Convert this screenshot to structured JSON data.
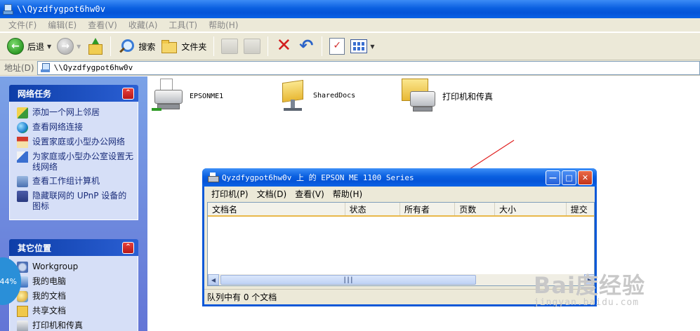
{
  "window": {
    "title": "\\\\Qyzdfygpot6hw0v"
  },
  "menubar": [
    {
      "label": "文件(F)"
    },
    {
      "label": "编辑(E)"
    },
    {
      "label": "查看(V)"
    },
    {
      "label": "收藏(A)"
    },
    {
      "label": "工具(T)"
    },
    {
      "label": "帮助(H)"
    }
  ],
  "toolbar": {
    "back_label": "后退",
    "search_label": "搜索",
    "folders_label": "文件夹"
  },
  "address": {
    "label": "地址(D)",
    "value": "\\\\Qyzdfygpot6hw0v"
  },
  "network_tasks": {
    "title": "网络任务",
    "items": [
      {
        "label": "添加一个网上邻居",
        "icon": "add-network-place-icon"
      },
      {
        "label": "查看网络连接",
        "icon": "network-connections-icon"
      },
      {
        "label": "设置家庭或小型办公网络",
        "icon": "home-network-icon"
      },
      {
        "label": "为家庭或小型办公室设置无线网络",
        "icon": "wireless-network-icon"
      },
      {
        "label": "查看工作组计算机",
        "icon": "workgroup-computers-icon"
      },
      {
        "label": "隐藏联网的 UPnP 设备的图标",
        "icon": "upnp-icon"
      }
    ]
  },
  "other_places": {
    "title": "其它位置",
    "items": [
      {
        "label": "Workgroup",
        "icon": "workgroup-icon"
      },
      {
        "label": "我的电脑",
        "icon": "my-computer-icon"
      },
      {
        "label": "我的文档",
        "icon": "my-documents-icon"
      },
      {
        "label": "共享文档",
        "icon": "shared-folder-icon"
      },
      {
        "label": "打印机和传真",
        "icon": "printers-icon"
      }
    ]
  },
  "content_items": [
    {
      "label": "EPSONME1",
      "icon": "printer-icon"
    },
    {
      "label": "SharedDocs",
      "icon": "shared-docs-icon"
    },
    {
      "label": "打印机和传真",
      "icon": "printers-faxes-icon"
    }
  ],
  "print_queue": {
    "title": "Qyzdfygpot6hw0v 上 的 EPSON ME 1100 Series",
    "menu": [
      {
        "label": "打印机(P)"
      },
      {
        "label": "文档(D)"
      },
      {
        "label": "查看(V)"
      },
      {
        "label": "帮助(H)"
      }
    ],
    "columns": [
      "文档名",
      "状态",
      "所有者",
      "页数",
      "大小",
      "提交"
    ],
    "status": "队列中有 0 个文档"
  },
  "progress": {
    "label": "44%",
    "value": 44
  },
  "watermark": {
    "logo": "Bai度经验",
    "sub": "jingyan.baidu.com"
  },
  "colors": {
    "titlebar": "#0a5fe0",
    "taskpane": "#6f8ee0",
    "arrow": "#e02020"
  }
}
